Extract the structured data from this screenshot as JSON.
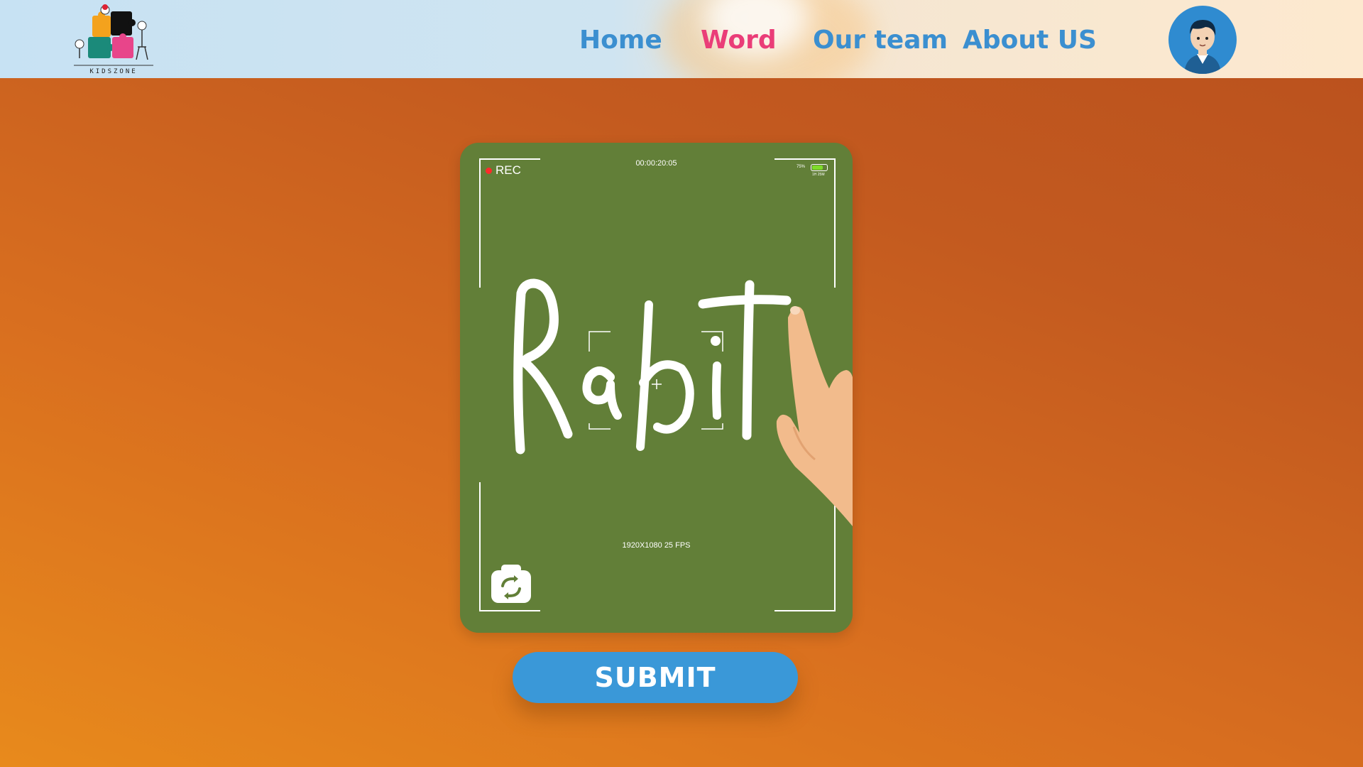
{
  "brand": {
    "logo_text": "KIDSZONE"
  },
  "nav": {
    "home": "Home",
    "word": "Word",
    "our_team": "Our team",
    "about_us": "About US"
  },
  "camera": {
    "rec_label": "REC",
    "timecode": "00:00:20:05",
    "battery_percent": "75%",
    "battery_level": 0.75,
    "battery_time": "1H 25M",
    "resolution": "1920X1080 25 FPS",
    "handwritten_word": "Rabit"
  },
  "submit_label": "SUBMIT",
  "colors": {
    "nav_link": "#3b8fd0",
    "nav_active": "#ea3d78",
    "camera_bg": "#627f38",
    "submit_bg": "#3a98d8",
    "avatar_bg": "#2f8bd0"
  },
  "icons": {
    "logo": "puzzle-logo-icon",
    "avatar": "user-avatar-icon",
    "switch_camera": "camera-switch-icon",
    "rec": "rec-dot-icon",
    "battery": "battery-icon"
  }
}
